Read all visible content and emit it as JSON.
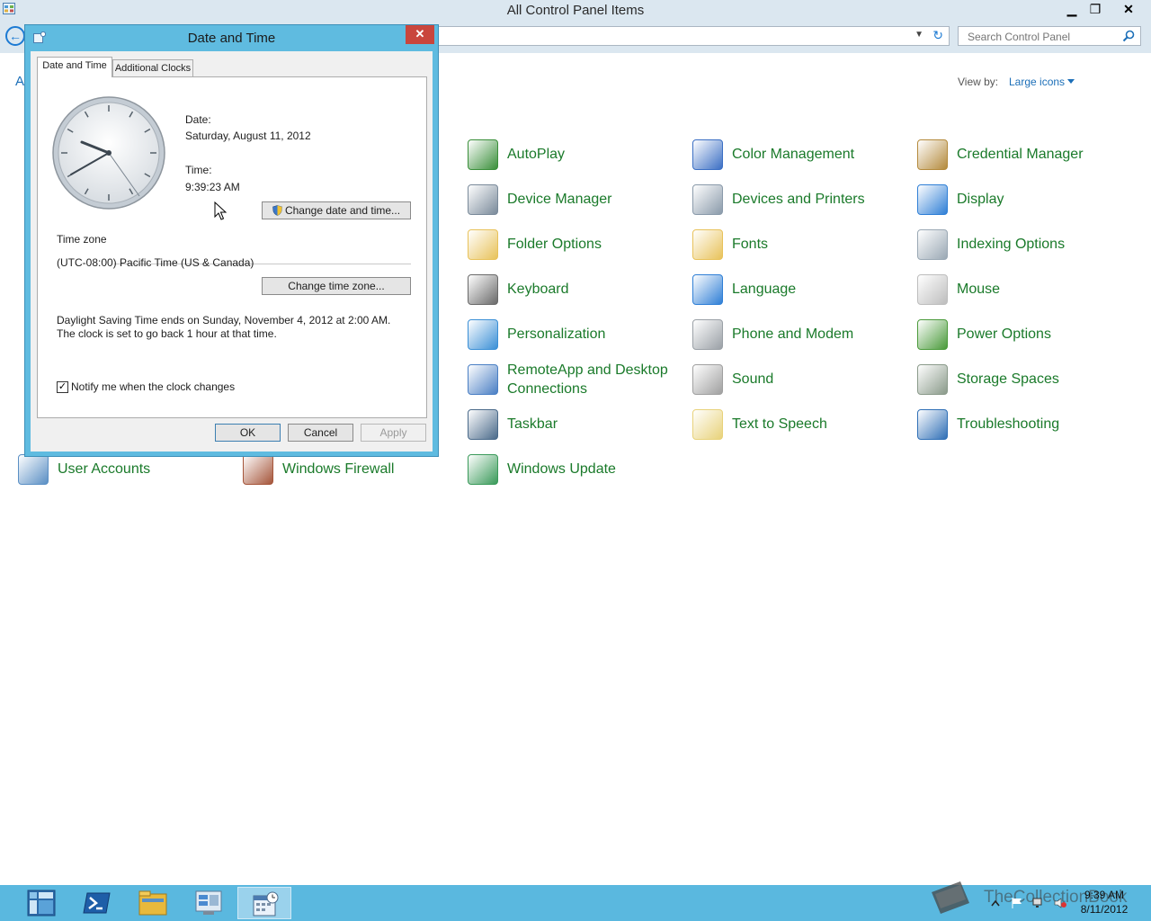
{
  "window": {
    "title": "All Control Panel Items",
    "controls": {
      "minimize": "▁",
      "maximize": "❐",
      "close": "✕"
    }
  },
  "nav": {
    "back_icon": "back-arrow-icon",
    "address_fragment": "A",
    "search_placeholder": "Search Control Panel"
  },
  "view_by": {
    "label": "View by:",
    "value": "Large icons"
  },
  "items": [
    {
      "label": "AutoPlay",
      "icon": "autoplay-icon",
      "color": "#3a8f3a"
    },
    {
      "label": "Color Management",
      "icon": "color-management-icon",
      "color": "#3b6fc4"
    },
    {
      "label": "Credential Manager",
      "icon": "credential-manager-icon",
      "color": "#b48a3c"
    },
    {
      "label": "Device Manager",
      "icon": "device-manager-icon",
      "color": "#7a8a9a"
    },
    {
      "label": "Devices and Printers",
      "icon": "printer-icon",
      "color": "#8a9aaa"
    },
    {
      "label": "Display",
      "icon": "display-icon",
      "color": "#2f7fd6"
    },
    {
      "label": "Folder Options",
      "icon": "folder-icon",
      "color": "#e8c25a"
    },
    {
      "label": "Fonts",
      "icon": "fonts-icon",
      "color": "#e8c25a"
    },
    {
      "label": "Indexing Options",
      "icon": "magnifier-icon",
      "color": "#9aa8b4"
    },
    {
      "label": "Keyboard",
      "icon": "keyboard-icon",
      "color": "#6a6a6a"
    },
    {
      "label": "Language",
      "icon": "language-icon",
      "color": "#2f7fd6"
    },
    {
      "label": "Mouse",
      "icon": "mouse-icon",
      "color": "#bdbdbd"
    },
    {
      "label": "Personalization",
      "icon": "personalization-icon",
      "color": "#3a8fd6"
    },
    {
      "label": "Phone and Modem",
      "icon": "phone-icon",
      "color": "#9aa0a6"
    },
    {
      "label": "Power Options",
      "icon": "battery-icon",
      "color": "#4a9a3a"
    },
    {
      "label": "RemoteApp and Desktop Connections",
      "icon": "remote-desktop-icon",
      "color": "#4a7fc4"
    },
    {
      "label": "Sound",
      "icon": "speaker-icon",
      "color": "#a0a0a0"
    },
    {
      "label": "Storage Spaces",
      "icon": "storage-icon",
      "color": "#8a9a8a"
    },
    {
      "label": "Taskbar",
      "icon": "taskbar-icon",
      "color": "#4a6a8a"
    },
    {
      "label": "Text to Speech",
      "icon": "speech-bubble-icon",
      "color": "#e8d27a"
    },
    {
      "label": "Troubleshooting",
      "icon": "troubleshooting-icon",
      "color": "#2f6fb6"
    },
    {
      "label": "User Accounts",
      "icon": "users-icon",
      "color": "#5a8fc4"
    },
    {
      "label": "Windows Firewall",
      "icon": "firewall-icon",
      "color": "#a5553a"
    },
    {
      "label": "Windows Update",
      "icon": "windows-update-icon",
      "color": "#3a9a5a"
    }
  ],
  "dialog": {
    "title": "Date and Time",
    "close": "✕",
    "tabs": [
      "Date and Time",
      "Additional Clocks"
    ],
    "date_label": "Date:",
    "date_value": "Saturday, August 11, 2012",
    "time_label": "Time:",
    "time_value": "9:39:23 AM",
    "change_datetime_button": "Change date and time...",
    "timezone_heading": "Time zone",
    "timezone_value": "(UTC-08:00) Pacific Time (US & Canada)",
    "change_timezone_button": "Change time zone...",
    "dst_text": "Daylight Saving Time ends on Sunday, November 4, 2012 at 2:00 AM. The clock is set to go back 1 hour at that time.",
    "notify_checkbox": {
      "label": "Notify me when the clock changes",
      "checked": true,
      "mark": "✓"
    },
    "buttons": {
      "ok": "OK",
      "cancel": "Cancel",
      "apply": "Apply"
    }
  },
  "taskbar": {
    "buttons": [
      "start-icon",
      "powershell-icon",
      "file-explorer-icon",
      "server-manager-icon",
      "date-time-icon"
    ],
    "watermark": "TheCollectionBook",
    "clock_time": "9:39 AM",
    "clock_date": "8/11/2012"
  },
  "colors": {
    "link_green": "#1a7a2a",
    "dialog_frame": "#5fbbe0",
    "taskbar": "#5ab8df",
    "close_red": "#c9463d"
  }
}
